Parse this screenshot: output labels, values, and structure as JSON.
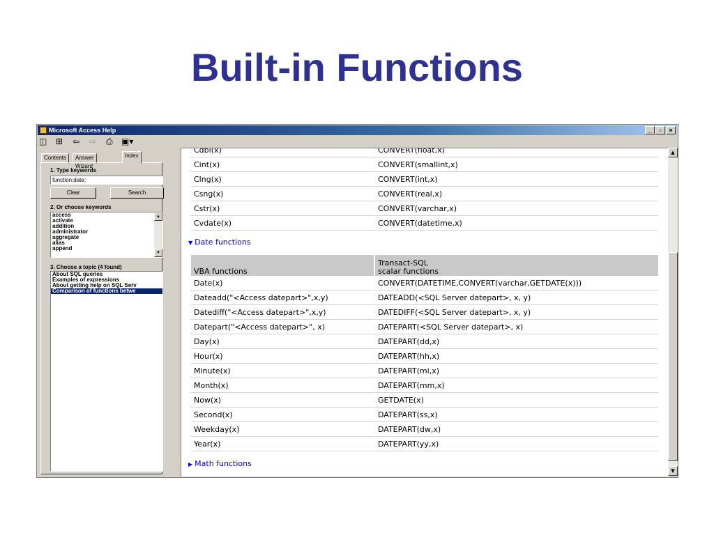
{
  "slide": {
    "title": "Built-in Functions"
  },
  "window": {
    "title": "Microsoft Access Help",
    "controls": {
      "minimize": "_",
      "restore": "▫",
      "close": "×"
    }
  },
  "toolbar": {
    "icons": [
      "show-hide-icon",
      "options-icon",
      "back-icon",
      "forward-icon",
      "print-icon",
      "options-menu-icon"
    ]
  },
  "nav": {
    "tabs": [
      "Contents",
      "Answer Wizard",
      "Index"
    ],
    "active_tab": "Index",
    "step1_label": "1. Type keywords",
    "keyword_value": "function;date;",
    "clear_label": "Clear",
    "search_label": "Search",
    "step2_label": "2. Or choose keywords",
    "keywords": [
      "access",
      "activate",
      "addition",
      "administrator",
      "aggregate",
      "alias",
      "append"
    ],
    "step3_label": "3. Choose a topic (4 found)",
    "topics": [
      "About SQL queries",
      "Examples of expressions",
      "About getting help on SQL Serv",
      "Comparison of functions betwe"
    ],
    "selected_topic_index": 3
  },
  "content": {
    "conversion_rows": [
      [
        "Cdbl(x)",
        "CONVERT(float,x)"
      ],
      [
        "Cint(x)",
        "CONVERT(smallint,x)"
      ],
      [
        "Clng(x)",
        "CONVERT(int,x)"
      ],
      [
        "Csng(x)",
        "CONVERT(real,x)"
      ],
      [
        "Cstr(x)",
        "CONVERT(varchar,x)"
      ],
      [
        "Cvdate(x)",
        "CONVERT(datetime,x)"
      ]
    ],
    "date_section_label": "Date functions",
    "date_header": {
      "col1": "VBA functions",
      "col2_line1": "Transact-SQL",
      "col2_line2": "scalar functions"
    },
    "date_rows": [
      [
        "Date(x)",
        "CONVERT(DATETIME,CONVERT(varchar,GETDATE(x)))"
      ],
      [
        "Dateadd(\"<Access datepart>\",x,y)",
        "DATEADD(<SQL Server datepart>, x, y)"
      ],
      [
        "Datediff(\"<Access datepart>\",x,y)",
        "DATEDIFF(<SQL Server datepart>, x, y)"
      ],
      [
        "Datepart(\"<Access datepart>\", x)",
        "DATEPART(<SQL Server datepart>, x)"
      ],
      [
        "Day(x)",
        "DATEPART(dd,x)"
      ],
      [
        "Hour(x)",
        "DATEPART(hh,x)"
      ],
      [
        "Minute(x)",
        "DATEPART(mi,x)"
      ],
      [
        "Month(x)",
        "DATEPART(mm,x)"
      ],
      [
        "Now(x)",
        "GETDATE(x)"
      ],
      [
        "Second(x)",
        "DATEPART(ss,x)"
      ],
      [
        "Weekday(x)",
        "DATEPART(dw,x)"
      ],
      [
        "Year(x)",
        "DATEPART(yy,x)"
      ]
    ],
    "math_section_label": "Math functions"
  }
}
